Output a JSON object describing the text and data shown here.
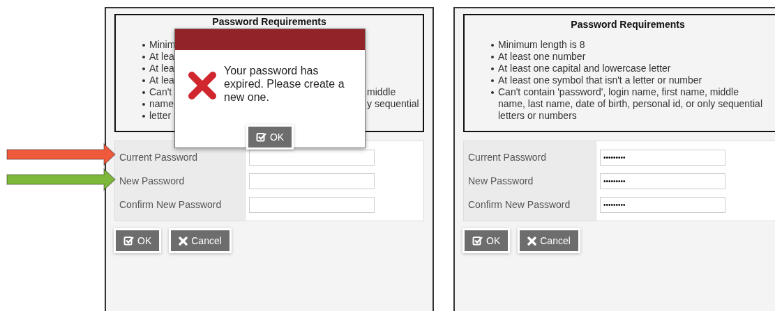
{
  "annotations": [
    {
      "kind": "arrow",
      "color": "#f05a3c"
    },
    {
      "kind": "arrow",
      "color": "#7db83a"
    }
  ],
  "panels": [
    {
      "requirements": {
        "title": "Password Requirements",
        "items": [
          {
            "left": "Minim"
          },
          {
            "left": "At lea"
          },
          {
            "left": "At lea"
          },
          {
            "left": "At lea"
          },
          {
            "left": "Can't",
            "right": "middle"
          },
          {
            "left": "name",
            "right": "y sequential"
          },
          {
            "left": "letter"
          }
        ]
      },
      "fields": [
        {
          "label": "Current Password"
        },
        {
          "label": "New Password"
        },
        {
          "label": "Confirm New Password"
        }
      ],
      "buttons": [
        {
          "kind": "ok",
          "label": "OK"
        },
        {
          "kind": "cancel",
          "label": "Cancel"
        }
      ],
      "dialog": {
        "message": "Your password has expired. Please create a new one.",
        "button": "OK"
      }
    },
    {
      "requirements": {
        "title": "Password Requirements",
        "items": [
          {
            "left": "Minimum length is 8"
          },
          {
            "left": "At least one number"
          },
          {
            "left": "At least one capital and lowercase letter"
          },
          {
            "left": "At least one symbol that isn't a letter or number"
          },
          {
            "left": "Can't contain 'password', login name, first name, middle name, last name, date of birth, personal id, or only sequential letters or numbers"
          }
        ]
      },
      "fields": [
        {
          "label": "Current Password",
          "value": "•••••••••"
        },
        {
          "label": "New Password",
          "value": "•••••••••"
        },
        {
          "label": "Confirm New Password",
          "value": "•••••••••"
        }
      ],
      "buttons": [
        {
          "kind": "ok",
          "label": "OK"
        },
        {
          "kind": "cancel",
          "label": "Cancel"
        }
      ]
    }
  ]
}
